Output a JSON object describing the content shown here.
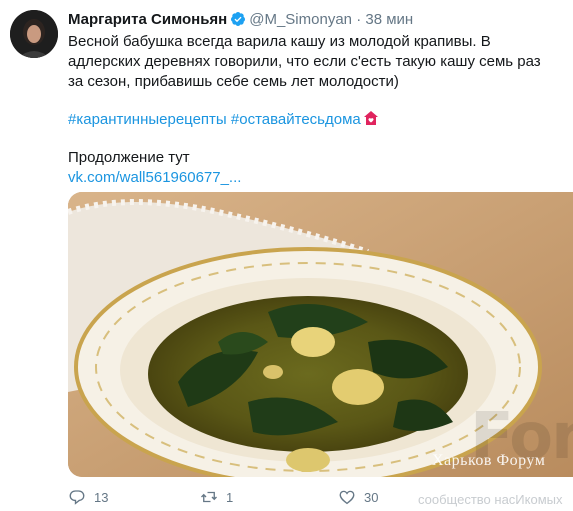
{
  "tweet": {
    "author_name": "Маргарита Симоньян",
    "handle": "@M_Simonyan",
    "separator": "·",
    "time": "38 мин",
    "text": "Весной бабушка всегда варила кашу из молодой крапивы. В адлерских деревнях говорили, что если с'есть такую кашу семь раз за сезон, прибавишь себе семь лет молодости)",
    "hashtags": [
      "#карантинныерецепты",
      "#оставайтесьдома"
    ],
    "continuation_label": "Продолжение тут",
    "link": "vk.com/wall561960677_..."
  },
  "media": {
    "watermark": "Харьков Форум",
    "watermark_logo": "Fon",
    "watermark_tag": "сообщество насИкомых"
  },
  "actions": {
    "replies": "13",
    "retweets": "1",
    "likes": "30"
  },
  "colors": {
    "link": "#1b95e0",
    "muted": "#657786",
    "verified": "#1da1f2"
  }
}
